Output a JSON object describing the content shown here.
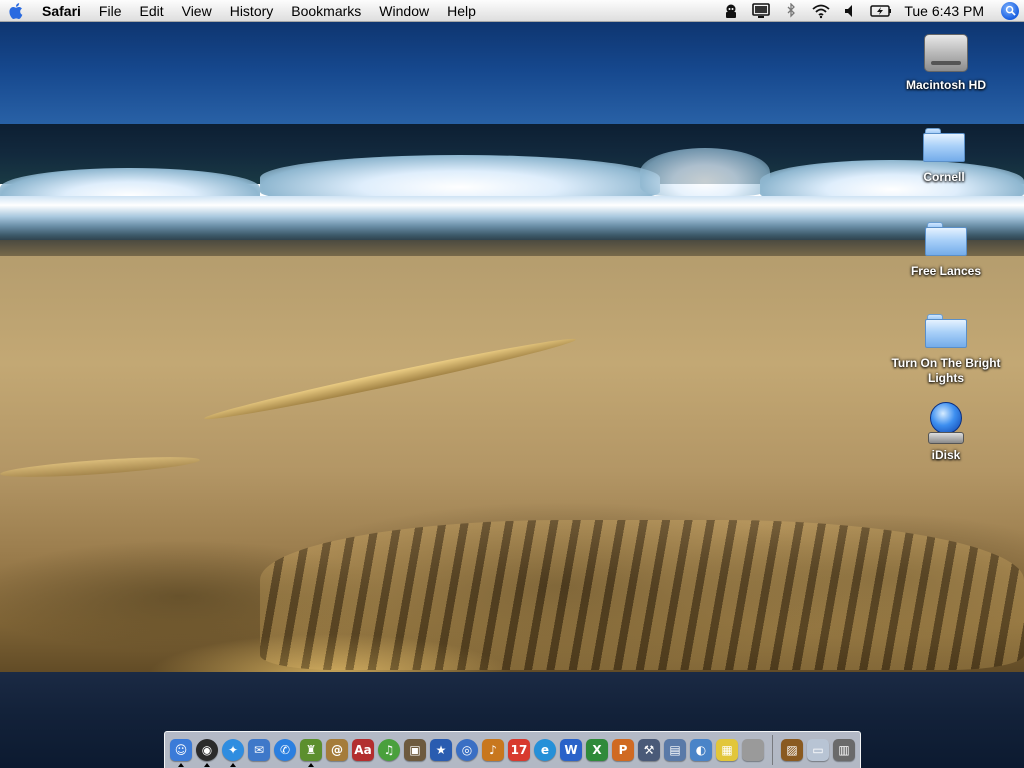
{
  "menubar": {
    "app_name": "Safari",
    "menus": [
      "File",
      "Edit",
      "View",
      "History",
      "Bookmarks",
      "Window",
      "Help"
    ],
    "status_icons": [
      "script-menu-icon",
      "display-icon",
      "bluetooth-icon",
      "wifi-icon",
      "volume-icon",
      "battery-icon"
    ],
    "clock": "Tue 6:43 PM"
  },
  "desktop": {
    "icons": [
      {
        "label": "Macintosh HD",
        "icon": "hard-drive-icon"
      },
      {
        "label": "Cornell",
        "icon": "folder-icon"
      },
      {
        "label": "Free Lances",
        "icon": "folder-icon"
      },
      {
        "label": "Turn On The Bright Lights",
        "icon": "folder-icon"
      },
      {
        "label": "iDisk",
        "icon": "idisk-icon"
      }
    ]
  },
  "dock": {
    "apps": [
      {
        "name": "finder-icon",
        "glyph": "☺",
        "color": "#3b7bd8",
        "running": true
      },
      {
        "name": "dashboard-icon",
        "glyph": "◉",
        "color": "#2b2b2b",
        "running": true
      },
      {
        "name": "safari-icon",
        "glyph": "✦",
        "color": "#2f8de0",
        "running": true
      },
      {
        "name": "mail-icon",
        "glyph": "✉",
        "color": "#3e78c9",
        "running": false
      },
      {
        "name": "ichat-icon",
        "glyph": "✆",
        "color": "#2a7fe0",
        "running": false
      },
      {
        "name": "automator-icon",
        "glyph": "♜",
        "color": "#5c8f2e",
        "running": true
      },
      {
        "name": "address-book-icon",
        "glyph": "@",
        "color": "#a57c3a",
        "running": false
      },
      {
        "name": "dictionary-icon",
        "glyph": "Aa",
        "color": "#b32e2e",
        "running": false
      },
      {
        "name": "itunes-icon",
        "glyph": "♫",
        "color": "#4aa03c",
        "running": false
      },
      {
        "name": "iphoto-icon",
        "glyph": "▣",
        "color": "#6d5a3e",
        "running": false
      },
      {
        "name": "imovie-icon",
        "glyph": "★",
        "color": "#2a5cb0",
        "running": false
      },
      {
        "name": "idvd-icon",
        "glyph": "◎",
        "color": "#3a6fc4",
        "running": false
      },
      {
        "name": "garageband-icon",
        "glyph": "♪",
        "color": "#c8771e",
        "running": false
      },
      {
        "name": "ical-icon",
        "glyph": "17",
        "color": "#d83a2e",
        "running": false
      },
      {
        "name": "iweb-icon",
        "glyph": "e",
        "color": "#2590d8",
        "running": false
      },
      {
        "name": "word-icon",
        "glyph": "W",
        "color": "#2a62c9",
        "running": false
      },
      {
        "name": "excel-icon",
        "glyph": "X",
        "color": "#2f8a3a",
        "running": false
      },
      {
        "name": "powerpoint-icon",
        "glyph": "P",
        "color": "#d06a22",
        "running": false
      },
      {
        "name": "xcode-icon",
        "glyph": "⚒",
        "color": "#4a5a78",
        "running": false
      },
      {
        "name": "remote-desktop-icon",
        "glyph": "▤",
        "color": "#5a7aa8",
        "running": false
      },
      {
        "name": "preview-icon",
        "glyph": "◐",
        "color": "#4a84c8",
        "running": false
      },
      {
        "name": "stickies-icon",
        "glyph": "▦",
        "color": "#e2c63a",
        "running": false
      },
      {
        "name": "system-preferences-icon",
        "glyph": "",
        "color": "#9a9a9a",
        "running": false
      }
    ],
    "docs": [
      {
        "name": "pictures-stack-icon",
        "glyph": "▨",
        "color": "#8a5a20"
      },
      {
        "name": "documents-stack-icon",
        "glyph": "▭",
        "color": "#b8c4d4"
      },
      {
        "name": "trash-icon",
        "glyph": "▥",
        "color": "#6a6a6a"
      }
    ]
  }
}
